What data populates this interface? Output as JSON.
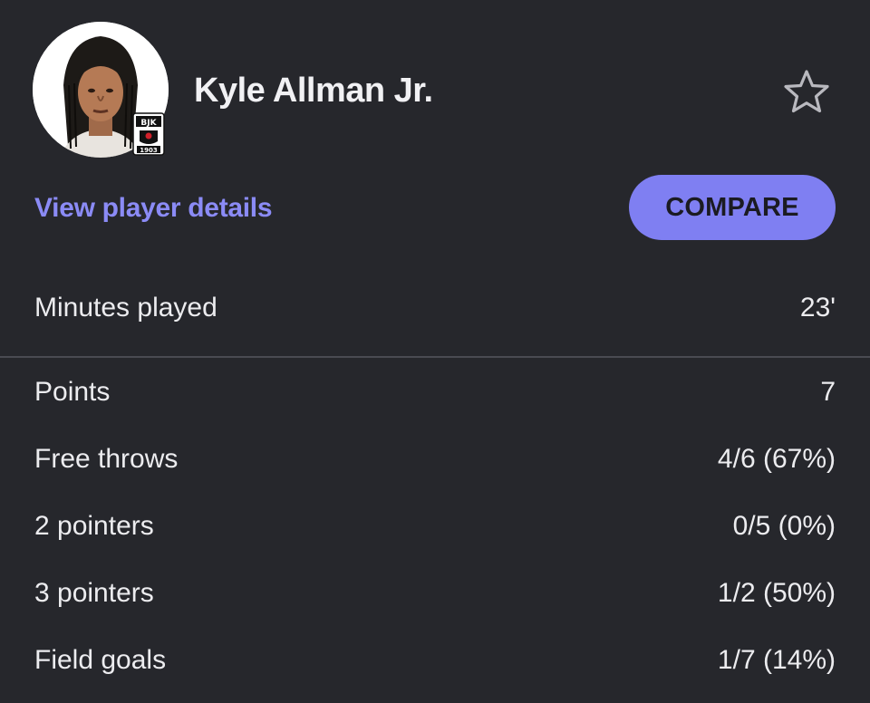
{
  "player": {
    "name": "Kyle Allman Jr.",
    "team_badge_text": "BJK 1903"
  },
  "actions": {
    "details_link": "View player details",
    "compare_button": "COMPARE",
    "favorite_icon": "star-outline-icon"
  },
  "colors": {
    "background": "#26272c",
    "accent": "#7f7ff2",
    "link": "#8b8bf6",
    "divider": "#4a4b52"
  },
  "summary": {
    "label": "Minutes played",
    "value": "23'"
  },
  "stats": [
    {
      "label": "Points",
      "value": "7"
    },
    {
      "label": "Free throws",
      "value": "4/6 (67%)"
    },
    {
      "label": "2 pointers",
      "value": "0/5 (0%)"
    },
    {
      "label": "3 pointers",
      "value": "1/2 (50%)"
    },
    {
      "label": "Field goals",
      "value": "1/7 (14%)"
    }
  ]
}
